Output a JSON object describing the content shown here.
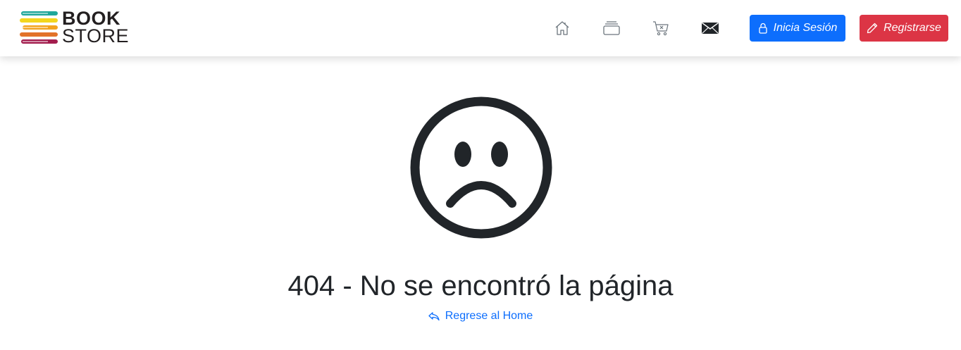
{
  "brand": {
    "line1": "BOOK",
    "line2": "STORE",
    "stripe_colors": [
      "#1fa79a",
      "#f3d61e",
      "#f3a31e",
      "#e2732a",
      "#a31d4e"
    ]
  },
  "nav": {
    "icons": [
      "home-icon",
      "collection-icon",
      "cart-x-icon",
      "envelope-icon"
    ]
  },
  "buttons": {
    "login_label": "Inicia Sesión",
    "register_label": "Registrarse"
  },
  "error": {
    "title": "404 - No se encontró la página",
    "link_label": "Regrese al Home"
  },
  "colors": {
    "primary": "#0d6efd",
    "danger": "#dc3545",
    "text": "#212529"
  }
}
